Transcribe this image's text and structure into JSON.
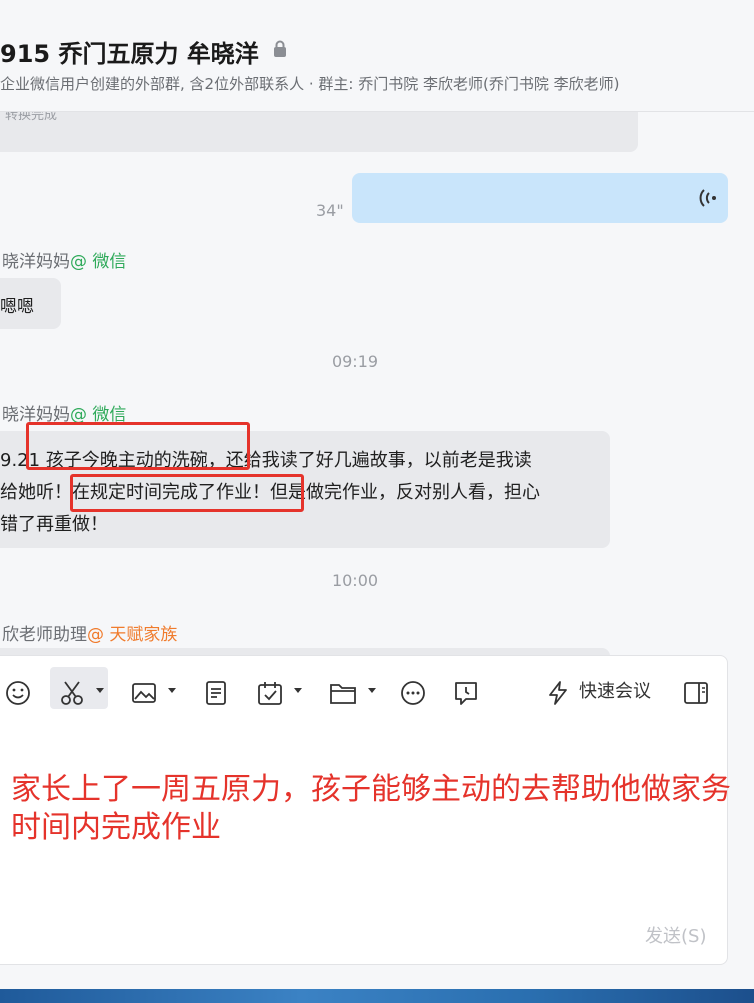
{
  "header": {
    "title": "915 乔门五原力 牟晓洋",
    "subtitle": "企业微信用户创建的外部群, 含2位外部联系人 · 群主: 乔门书院 李欣老师(乔门书院 李欣老师)"
  },
  "messages": {
    "converted_status": "转换完成",
    "voice_duration": "34\"",
    "sender1_name": "晓洋妈妈",
    "sender1_tag": "@ 微信",
    "msg1": "嗯嗯",
    "time1": "09:19",
    "sender2_name": "晓洋妈妈",
    "sender2_tag": "@ 微信",
    "msg2_line1": "9.21  孩子今晚主动的洗碗，还给我读了好几遍故事，以前老是我读",
    "msg2_line2": "给她听！在规定时间完成了作业！但是做完作业，反对别人看，担心",
    "msg2_line3": "错了再重做！",
    "time2": "10:00",
    "sender3_name": "欣老师助理",
    "sender3_tag": "@ 天赋家族"
  },
  "composer": {
    "quick_meeting_label": "快速会议",
    "annotation_line1": "家长上了一周五原力，孩子能够主动的去帮助他做家务",
    "annotation_line2": "时间内完成作业",
    "send_label": "发送(S)"
  },
  "colors": {
    "accent_red": "#e5332b",
    "wechat_green": "#2faa5a",
    "tag_orange": "#f07b2c",
    "voice_bubble": "#c9e5fb"
  }
}
